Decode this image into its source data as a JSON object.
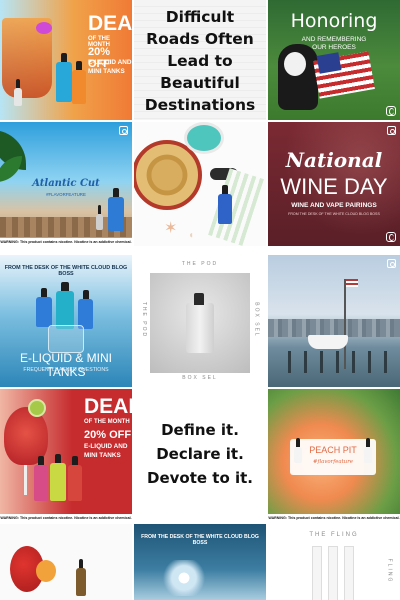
{
  "tiles": {
    "deal_top": {
      "title": "DEAL",
      "line1": "OF THE MONTH",
      "line2": "20% OFF",
      "line3": "E-LIQUID AND",
      "line4": "MINI TANKS"
    },
    "quote_roads": {
      "text": "Difficult Roads Often Lead to Beautiful Destinations"
    },
    "honoring": {
      "title": "Honoring",
      "sub1": "AND REMEMBERING",
      "sub2": "OUR HEROES"
    },
    "atlantic": {
      "title": "Atlantic Cut",
      "sub": "#FLAVORFEATURE"
    },
    "wine_day": {
      "title": "National",
      "title2": "WINE DAY",
      "sub": "WINE AND VAPE PAIRINGS",
      "tiny": "FROM THE DESK OF THE WHITE CLOUD BLOG BOSS"
    },
    "desk_eliquid": {
      "header": "FROM THE DESK OF THE WHITE CLOUD BLOG BOSS",
      "title": "E-LIQUID & MINI TANKS",
      "sub": "FREQUENTLY ASKED QUESTIONS"
    },
    "pod": {
      "top": "THE POD",
      "bottom": "BOX SEL",
      "side_left": "THE POD",
      "side_right": "BOX SEL"
    },
    "deal_bottom": {
      "title": "DEAL",
      "line1": "OF THE MONTH",
      "line2": "20% OFF",
      "line3": "E-LIQUID AND",
      "line4": "MINI TANKS"
    },
    "define": {
      "line1": "Define it.",
      "line2": "Declare it.",
      "line3": "Devote to it."
    },
    "peach": {
      "title": "PEACH PIT",
      "sub": "#flavorfeature"
    },
    "desk_bottom": {
      "header": "FROM THE DESK OF THE WHITE CLOUD BLOG BOSS"
    },
    "fling": {
      "title": "THE FLING",
      "side": "FLING"
    }
  },
  "warning_text": "WARNING: This product contains nicotine. Nicotine is an addictive chemical.",
  "colors": {
    "brand_teal": "#1f9aa6",
    "deal_red": "#c62b2e",
    "wine_red": "#7b2a33"
  }
}
